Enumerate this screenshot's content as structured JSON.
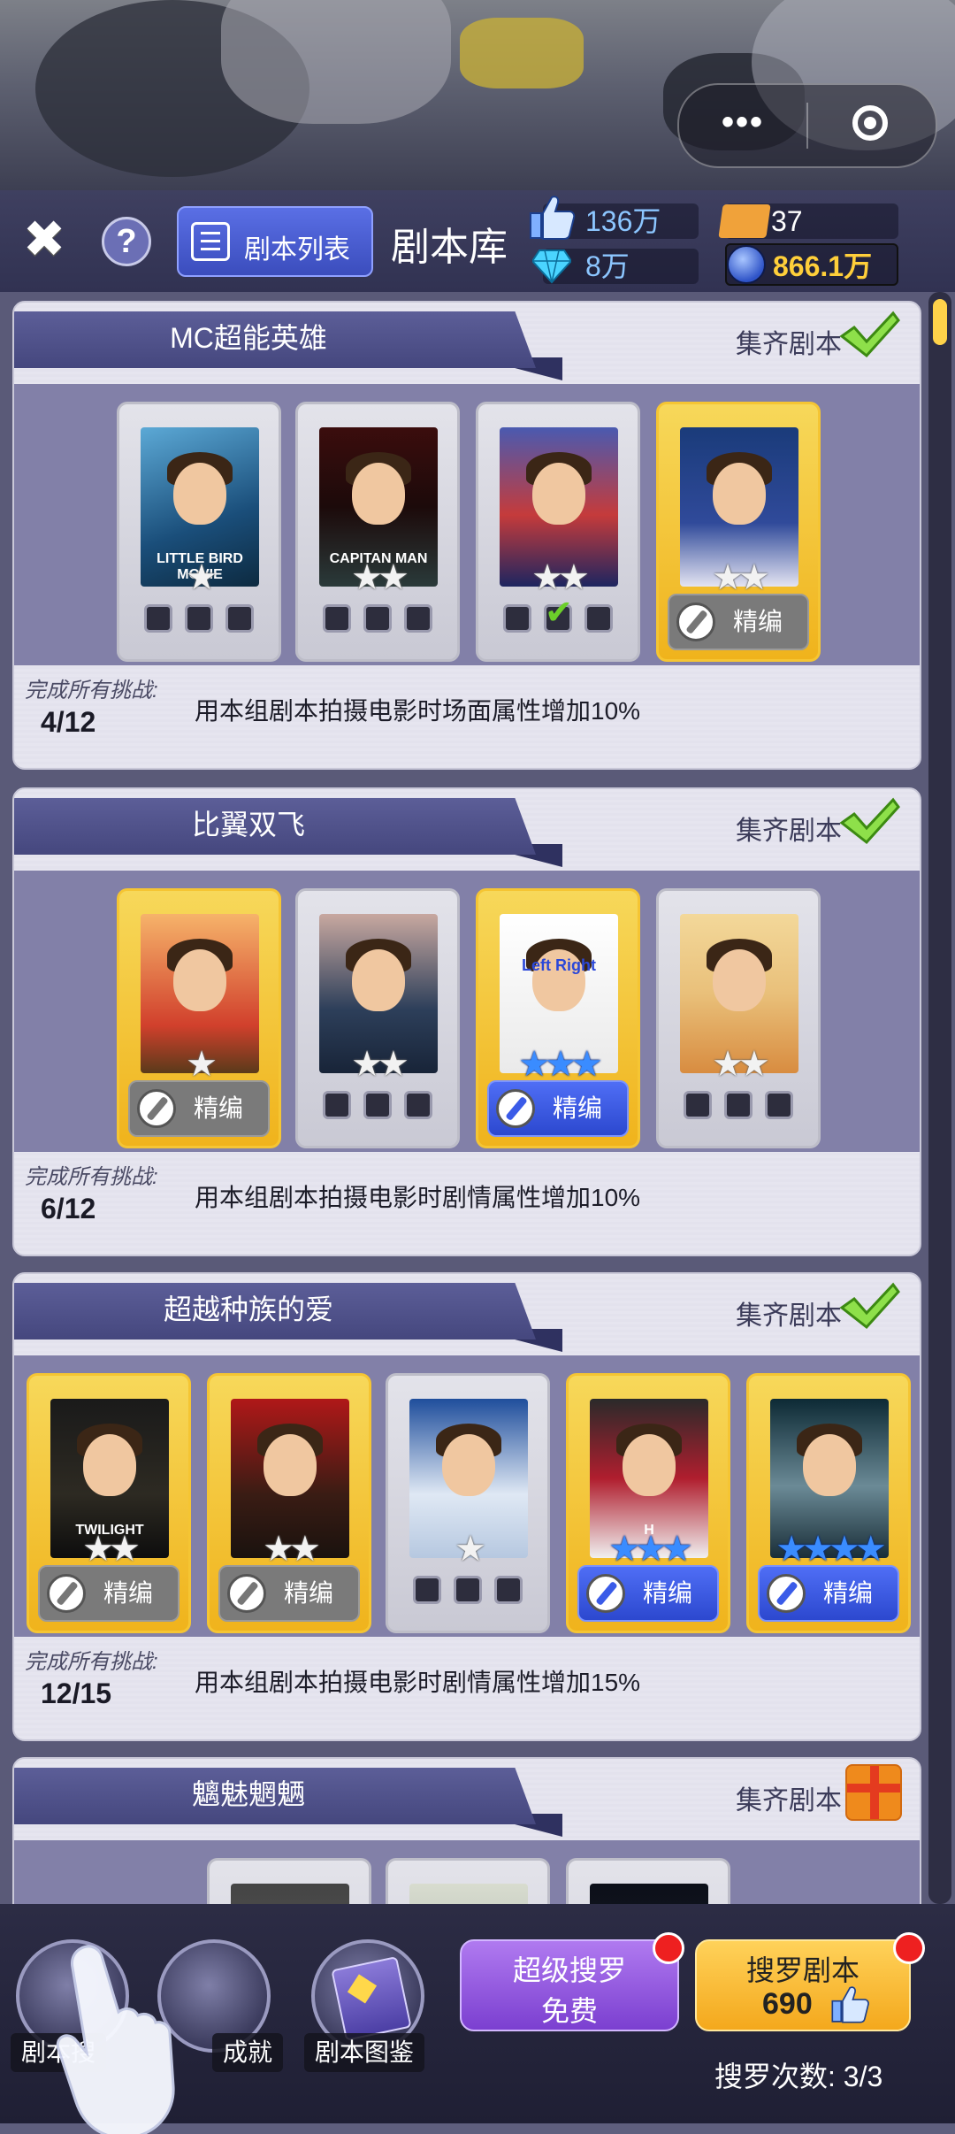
{
  "header": {
    "list_button_label": "剧本列表",
    "title": "剧本库",
    "likes": "136万",
    "gems": "8万",
    "tickets": "37",
    "coins": "866.1万"
  },
  "groups": [
    {
      "title": "MC超能英雄",
      "collect_label": "集齐剧本",
      "collect_status": "complete",
      "progress_label": "完成所有挑战:",
      "progress": "4/12",
      "bonus": "用本组剧本拍摄电影时场面属性增加10%",
      "cards": [
        {
          "poster": "p1",
          "poster_text": "LITTLE BIRD MOVIE",
          "stars": 1,
          "star_color": "gray",
          "slots": [
            0,
            0,
            0
          ],
          "edit": null
        },
        {
          "poster": "p2",
          "poster_text": "CAPITAN MAN",
          "stars": 2,
          "star_color": "gray",
          "slots": [
            0,
            0,
            0
          ],
          "edit": null
        },
        {
          "poster": "p3",
          "poster_text": "",
          "stars": 2,
          "star_color": "gray",
          "slots": [
            0,
            1,
            0
          ],
          "edit": null
        },
        {
          "poster": "p4",
          "poster_text": "",
          "stars": 2,
          "star_color": "gray",
          "slots": null,
          "edit": "精编",
          "edit_style": "gray",
          "gold": true
        }
      ]
    },
    {
      "title": "比翼双飞",
      "collect_label": "集齐剧本",
      "collect_status": "complete",
      "progress_label": "完成所有挑战:",
      "progress": "6/12",
      "bonus": "用本组剧本拍摄电影时剧情属性增加10%",
      "cards": [
        {
          "poster": "p5",
          "poster_text": "",
          "stars": 1,
          "star_color": "gray",
          "slots": null,
          "edit": "精编",
          "edit_style": "gray",
          "gold": true
        },
        {
          "poster": "p6",
          "poster_text": "",
          "stars": 2,
          "star_color": "gray",
          "slots": [
            0,
            0,
            0
          ],
          "edit": null
        },
        {
          "poster": "p7",
          "poster_text": "Left  Right",
          "stars": 3,
          "star_color": "blue",
          "slots": null,
          "edit": "精编",
          "edit_style": "blue",
          "gold": true
        },
        {
          "poster": "p8",
          "poster_text": "",
          "stars": 2,
          "star_color": "gray",
          "slots": [
            0,
            0,
            0
          ],
          "edit": null
        }
      ]
    },
    {
      "title": "超越种族的爱",
      "collect_label": "集齐剧本",
      "collect_status": "complete",
      "progress_label": "完成所有挑战:",
      "progress": "12/15",
      "bonus": "用本组剧本拍摄电影时剧情属性增加15%",
      "cards": [
        {
          "poster": "p9",
          "poster_text": "TWILIGHT",
          "stars": 2,
          "star_color": "gray",
          "slots": null,
          "edit": "精编",
          "edit_style": "gray",
          "gold": true
        },
        {
          "poster": "p10",
          "poster_text": "",
          "stars": 2,
          "star_color": "gray",
          "slots": null,
          "edit": "精编",
          "edit_style": "gray",
          "gold": true
        },
        {
          "poster": "p11",
          "poster_text": "",
          "stars": 1,
          "star_color": "gray",
          "slots": [
            0,
            0,
            0
          ],
          "edit": null
        },
        {
          "poster": "p12",
          "poster_text": "H",
          "stars": 3,
          "star_color": "blue",
          "slots": null,
          "edit": "精编",
          "edit_style": "blue",
          "gold": true
        },
        {
          "poster": "p13",
          "poster_text": "",
          "stars": 4,
          "star_color": "blue",
          "slots": null,
          "edit": "精编",
          "edit_style": "blue",
          "gold": true
        }
      ]
    },
    {
      "title": "魑魅魍魉",
      "collect_label": "集齐剧本",
      "collect_status": "reward",
      "cards": [
        {
          "poster": "p14"
        },
        {
          "poster": "p15"
        },
        {
          "poster": "p16"
        }
      ]
    }
  ],
  "bottom": {
    "search_script_tab": "剧本搜",
    "achievement_tab": "成就",
    "catalog_tab": "剧本图鉴",
    "super_search_title": "超级搜罗",
    "super_search_sub": "免费",
    "search_title": "搜罗剧本",
    "search_cost": "690",
    "search_count_label": "搜罗次数: 3/3"
  },
  "colors": {
    "accent_blue": "#3b4dbd",
    "gold": "#f0b31c",
    "purple_button": "#7b3fd0",
    "check_green": "#6ccf2a"
  }
}
